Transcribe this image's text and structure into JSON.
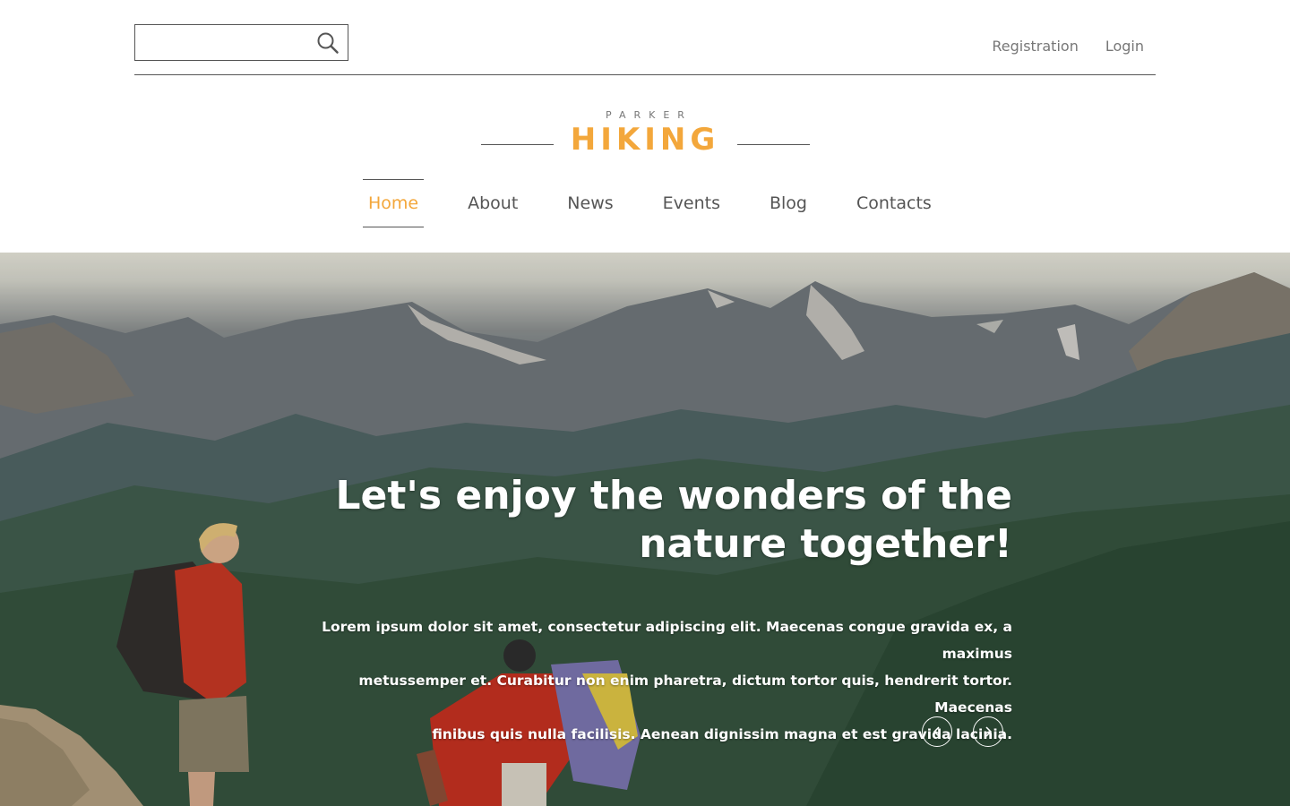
{
  "header": {
    "search": {
      "value": "",
      "placeholder": ""
    },
    "links": {
      "registration": "Registration",
      "login": "Login"
    }
  },
  "logo": {
    "small": "PARKER",
    "big": "HIKING"
  },
  "nav": {
    "items": [
      {
        "label": "Home",
        "active": true
      },
      {
        "label": "About"
      },
      {
        "label": "News"
      },
      {
        "label": "Events"
      },
      {
        "label": "Blog"
      },
      {
        "label": "Contacts"
      }
    ]
  },
  "hero": {
    "title_line1": "Let's enjoy the wonders of the",
    "title_line2": "nature together!",
    "text_line1": "Lorem ipsum dolor sit amet, consectetur adipiscing elit. Maecenas congue gravida ex, a maximus",
    "text_line2": "metussemper et. Curabitur non enim pharetra, dictum tortor quis, hendrerit tortor. Maecenas",
    "text_line3": "finibus quis nulla facilisis. Aenean dignissim magna et est gravida lacinia."
  },
  "colors": {
    "accent": "#f3a73b",
    "text": "#555555",
    "muted": "#777777"
  },
  "icons": {
    "search": "search-icon",
    "prev": "chevron-left-icon",
    "next": "chevron-right-icon"
  }
}
